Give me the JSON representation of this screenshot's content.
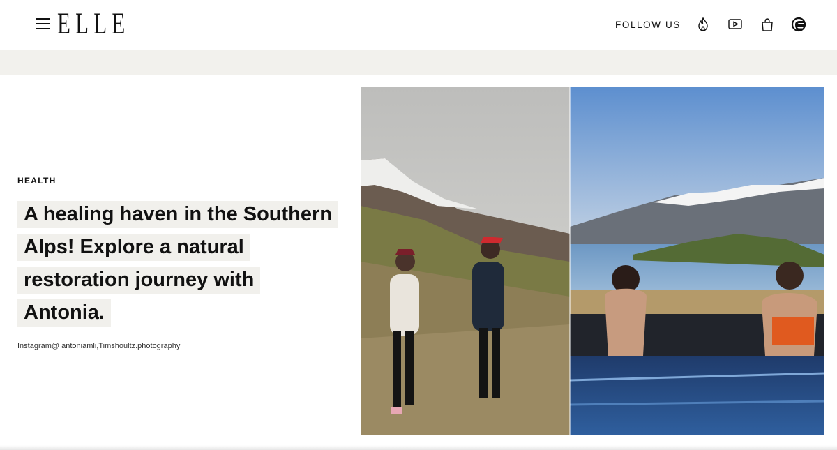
{
  "header": {
    "logo_text": "ELLE",
    "follow_label": "FOLLOW US",
    "social_icons": [
      "flame-icon",
      "play-icon",
      "shopping-bag-icon",
      "circle-logo-icon"
    ]
  },
  "article": {
    "category": "HEALTH",
    "headline": "A healing haven in the Southern Alps! Explore a natural restoration journey with Antonia.",
    "credit": "Instagram@ antoniamli,Timshoultz.photography"
  },
  "colors": {
    "band": "#f2f1ed",
    "headline_highlight": "#f1f0ec",
    "text": "#111111"
  }
}
